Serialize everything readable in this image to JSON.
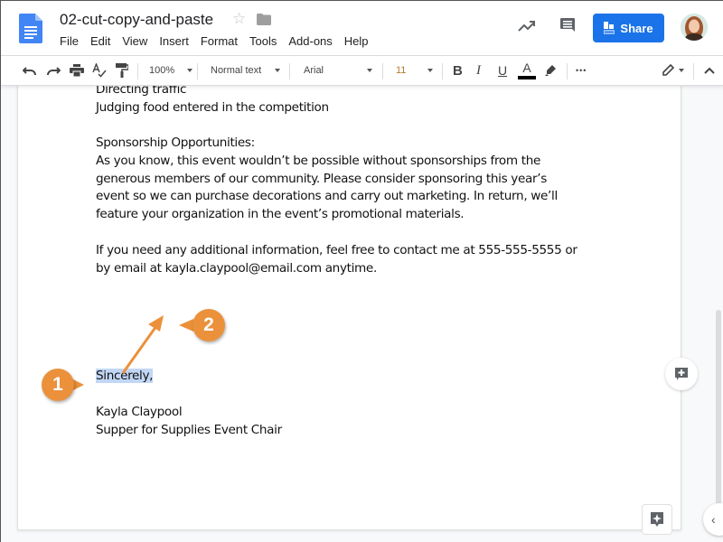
{
  "header": {
    "title": "02-cut-copy-and-paste",
    "menu": [
      "File",
      "Edit",
      "View",
      "Insert",
      "Format",
      "Tools",
      "Add-ons",
      "Help"
    ],
    "share_label": "Share"
  },
  "toolbar": {
    "zoom": "100%",
    "style": "Normal text",
    "font": "Arial",
    "font_size": "11",
    "bold": "B",
    "italic": "I",
    "underline": "U",
    "text_color_glyph": "A",
    "more": "•••"
  },
  "document": {
    "lines": [
      "Directing traffic",
      "Judging food entered in the competition",
      "",
      "Sponsorship Opportunities:",
      "As you know, this event wouldn’t be possible without sponsorships from the",
      "generous members of our community. Please consider sponsoring this year’s",
      "event so we can purchase decorations and carry out marketing. In return, we’ll",
      "feature your organization in the event’s promotional materials.",
      "",
      "If you need any additional information, feel free to contact me at 555-555-5555 or",
      "by email at kayla.claypool@email.com anytime."
    ],
    "selected_text": "Sincerely,",
    "signature": [
      "Kayla Claypool",
      "Supper for Supplies Event Chair"
    ]
  },
  "callouts": {
    "step1": "1",
    "step2": "2",
    "color": "#eb913b"
  },
  "colors": {
    "share": "#1a73e8",
    "selection": "#c2d7f5"
  }
}
